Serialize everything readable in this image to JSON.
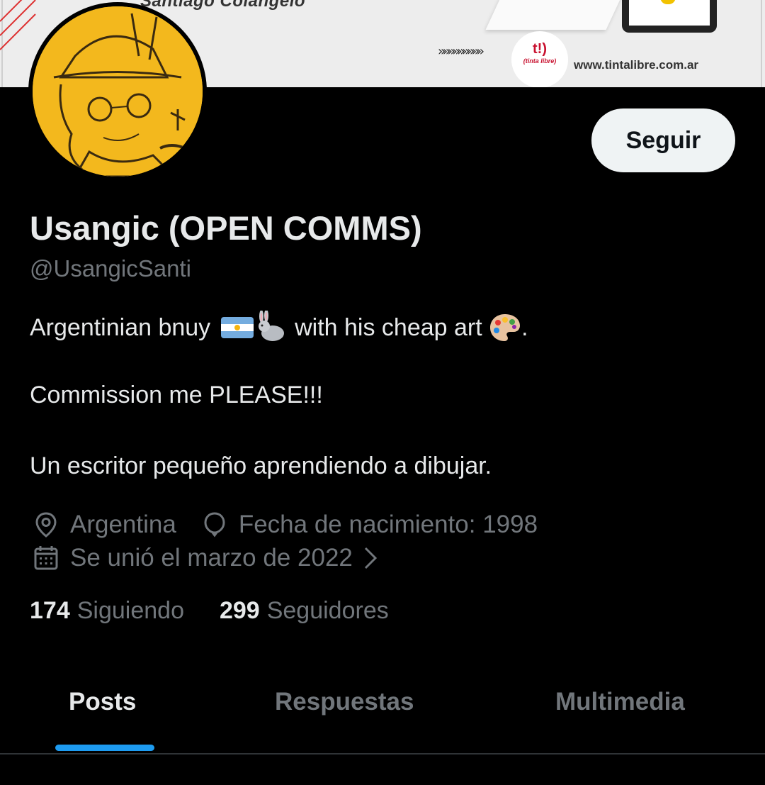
{
  "banner": {
    "author_text": "Santiago Colangelo",
    "arrows": "»»»»»»»»»",
    "logo_mark": "t!)",
    "logo_sub": "(tinta libre)",
    "url": "www.tintalibre.com.ar"
  },
  "profile": {
    "display_name": "Usangic (OPEN COMMS)",
    "handle": "@UsangicSanti",
    "follow_label": "Seguir",
    "bio": {
      "line1_start": "Argentinian bnuy ",
      "line1_flag_icon": "argentina-flag-icon",
      "line1_rabbit_icon": "rabbit-icon",
      "line1_middle": " with his cheap art ",
      "line1_palette_icon": "palette-icon",
      "line1_end": ".",
      "line2": "Commission me PLEASE!!!",
      "line3": "Un escritor pequeño aprendiendo a dibujar."
    },
    "location": "Argentina",
    "birth": "Fecha de nacimiento: 1998",
    "joined": "Se unió el marzo de 2022",
    "following_count": "174",
    "following_label": "Siguiendo",
    "followers_count": "299",
    "followers_label": "Seguidores"
  },
  "tabs": [
    {
      "label": "Posts",
      "active": true
    },
    {
      "label": "Respuestas",
      "active": false
    },
    {
      "label": "Multimedia",
      "active": false
    }
  ],
  "colors": {
    "background": "#000000",
    "text_primary": "#e7e9ea",
    "text_secondary": "#71767b",
    "accent_blue": "#1d9bf0",
    "follow_button_bg": "#eff3f4"
  }
}
